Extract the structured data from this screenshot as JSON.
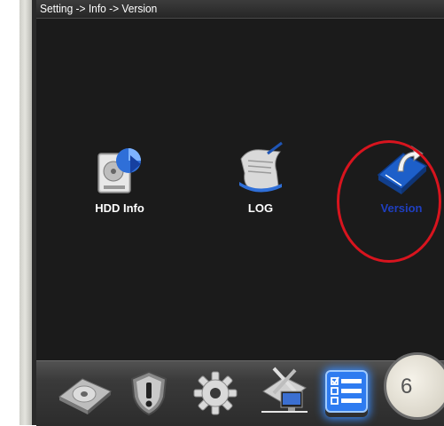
{
  "header": {
    "breadcrumb": "Setting -> Info -> Version"
  },
  "tiles": [
    {
      "label": "HDD Info",
      "icon": "hdd-info-icon"
    },
    {
      "label": "LOG",
      "icon": "log-icon"
    },
    {
      "label": "Version",
      "icon": "version-icon",
      "selected": true
    }
  ],
  "taskbar": {
    "items": [
      {
        "icon": "disk-icon"
      },
      {
        "icon": "shield-alert-icon"
      },
      {
        "icon": "gear-icon"
      },
      {
        "icon": "tools-network-icon"
      },
      {
        "icon": "info-checklist-icon",
        "active": true
      }
    ],
    "page_number": "6"
  },
  "colors": {
    "background": "#1b1b1b",
    "highlight_ring": "#d8141e",
    "selected_label": "#1f3fc0",
    "active_glow": "#3a8cff"
  }
}
